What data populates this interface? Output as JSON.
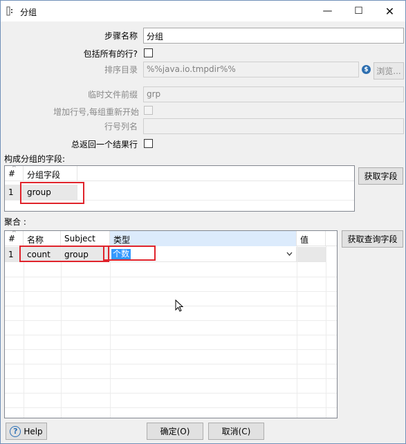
{
  "window": {
    "title": "分组",
    "minimize": "—",
    "maximize": "☐",
    "close": "✕"
  },
  "form": {
    "step_name_label": "步骤名称",
    "step_name_value": "分组",
    "include_all_rows_label": "包括所有的行?",
    "sort_dir_label": "排序目录",
    "sort_dir_value": "%%java.io.tmpdir%%",
    "browse_button": "浏览...",
    "temp_prefix_label": "临时文件前缀",
    "temp_prefix_value": "grp",
    "add_line_number_label": "增加行号,每组重新开始",
    "line_number_field_label": "行号列名",
    "line_number_field_value": "",
    "always_return_label": "总返回一个结果行"
  },
  "group_fields": {
    "section_label": "构成分组的字段:",
    "columns": [
      "#",
      "分组字段"
    ],
    "rows": [
      {
        "no": "1",
        "field": "group"
      }
    ],
    "get_fields_button": "获取字段"
  },
  "aggregates": {
    "section_label": "聚合 :",
    "columns": [
      "#",
      "名称",
      "Subject",
      "类型",
      "值"
    ],
    "rows": [
      {
        "no": "1",
        "name": "count",
        "subject": "group",
        "type": "个数",
        "value": ""
      }
    ],
    "get_lookup_button": "获取查询字段"
  },
  "footer": {
    "help": "Help",
    "ok": "确定(O)",
    "cancel": "取消(C)"
  },
  "icons": {
    "help": "?",
    "variable": "$"
  }
}
